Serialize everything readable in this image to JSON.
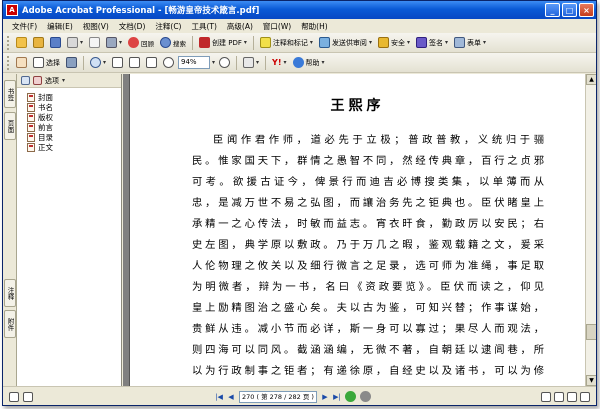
{
  "window": {
    "app_icon": "acrobat-icon",
    "title": "Adobe Acrobat Professional - [畅游皇帝技术箴言.pdf]",
    "buttons": {
      "minimize": "_",
      "maximize": "□",
      "close": "×"
    }
  },
  "menu": [
    "文件(F)",
    "编辑(E)",
    "视图(V)",
    "文档(D)",
    "注释(C)",
    "工具(T)",
    "高级(A)",
    "窗口(W)",
    "帮助(H)"
  ],
  "toolbar1": {
    "create_pdf": "创建 PDF",
    "review_comment": "注释和标记",
    "send_review": "发送供审阅",
    "secure": "安全",
    "sign": "签名",
    "forms": "表单",
    "icons": [
      "open-icon",
      "folder-icon",
      "save-icon",
      "print-icon",
      "email-icon",
      "attach-icon",
      "organizer-icon",
      "search-icon"
    ]
  },
  "toolbar2": {
    "hand_tool": "选择",
    "zoom_value": "94%",
    "help": "帮助",
    "icons": [
      "hand-icon",
      "snapshot-icon",
      "zoom-icon",
      "fit-page-icon",
      "zoom-out-icon",
      "zoom-in-icon",
      "rotate-icon",
      "yahoo-icon",
      "help-icon"
    ]
  },
  "left_panel": {
    "tabs": [
      "书签",
      "页面",
      "注释",
      "附件"
    ],
    "header_option": "选项",
    "bookmarks": [
      "封面",
      "书名",
      "版权",
      "前言",
      "目录",
      "正文"
    ]
  },
  "page": {
    "title": "王熙序",
    "lines": [
      "臣闻作君作师，道必先于立极；普政普教，义统归于骊",
      "民。惟家国天下，群情之愚智不同，然经传典章，百行之贞邪",
      "可考。欲援古证今，俾景行而迪吉必博搜类集，以单薄而从",
      "忠，是减万世不易之弘图，而讓治务先之钜典也。臣伏睹皇上",
      "承精一之心传法，时敏而益志。宵衣旰食，勤政厉以安民；右",
      "史左图，典学原以敷政。乃于万几之暇，鉴观载籍之文，爰采",
      "人伦物理之攸关以及细行微言之足录，选可师为准绳，事足取",
      "为明微者，辩为一书，名曰《资政要览》。臣伏而读之，仰见",
      "皇上励精图治之盛心矣。夫以古为鉴，可知兴替；作事谋始，",
      "贵鲜从违。减小节而必详，斯一身可以寡过；果尽人而观法，",
      "则四海可以同风。截涵涵编，无微不著，自朝廷以逮闾巷，所",
      "以为行政制事之钜者；有递徐原，自经史以及诸书，可以为修"
    ]
  },
  "statusbar": {
    "page_field": "270 ( 第 278 / 282 页 )"
  },
  "colors": {
    "titlebar": "#0a5ad6",
    "chrome": "#ece9d8",
    "doc_background": "#808080"
  }
}
